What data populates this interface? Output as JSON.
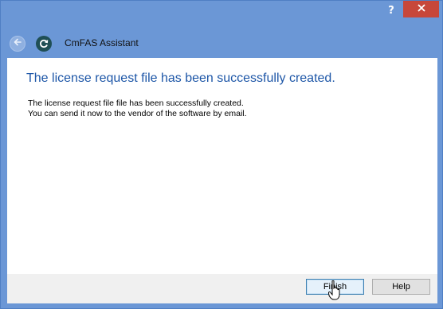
{
  "titlebar": {
    "help_glyph": "?",
    "close_icon": "close-icon"
  },
  "header": {
    "back_icon": "back-arrow-icon",
    "app_icon": "cmfas-icon",
    "title": "CmFAS Assistant"
  },
  "main": {
    "heading": "The license request file has been successfully created.",
    "line1": "The license request file file has been successfully created.",
    "line2": "You can send it now to the vendor of the software by email."
  },
  "footer": {
    "finish_label": "Finish",
    "help_label": "Help"
  },
  "colors": {
    "frame": "#6b97d6",
    "close": "#c7473a",
    "heading": "#1d56a7"
  }
}
